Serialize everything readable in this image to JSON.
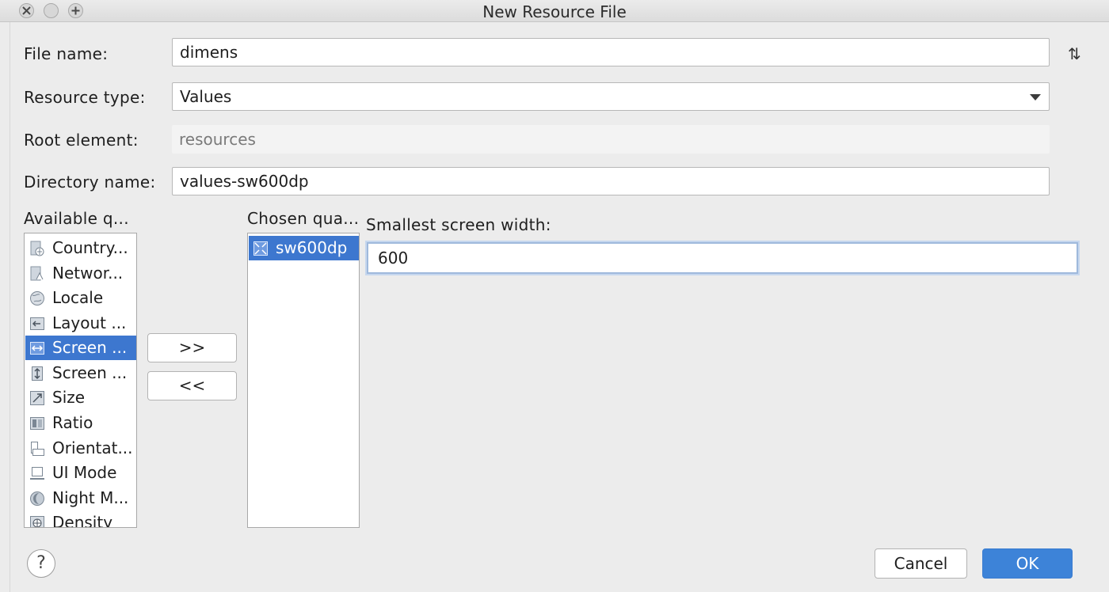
{
  "window": {
    "title": "New Resource File"
  },
  "form": {
    "file_name_label": "File name:",
    "file_name_value": "dimens",
    "resource_type_label": "Resource type:",
    "resource_type_value": "Values",
    "root_element_label": "Root element:",
    "root_element_value": "resources",
    "directory_name_label": "Directory name:",
    "directory_name_value": "values-sw600dp"
  },
  "qualifiers": {
    "available_label": "Available q...",
    "chosen_label": "Chosen qua...",
    "available": [
      {
        "label": "Country...",
        "icon": "country-icon"
      },
      {
        "label": "Networ...",
        "icon": "network-icon"
      },
      {
        "label": "Locale",
        "icon": "globe-icon"
      },
      {
        "label": "Layout ...",
        "icon": "layout-direction-icon"
      },
      {
        "label": "Screen ...",
        "icon": "screen-width-icon",
        "selected": true
      },
      {
        "label": "Screen ...",
        "icon": "screen-height-icon"
      },
      {
        "label": "Size",
        "icon": "size-icon"
      },
      {
        "label": "Ratio",
        "icon": "ratio-icon"
      },
      {
        "label": "Orientat...",
        "icon": "orientation-icon"
      },
      {
        "label": "UI Mode",
        "icon": "ui-mode-icon"
      },
      {
        "label": "Night M...",
        "icon": "night-mode-icon"
      },
      {
        "label": "Density",
        "icon": "density-icon"
      }
    ],
    "chosen": [
      {
        "label": "sw600dp",
        "icon": "smallest-width-icon",
        "selected": true
      }
    ],
    "add_button": ">>",
    "remove_button": "<<"
  },
  "detail": {
    "label": "Smallest screen width:",
    "value": "600"
  },
  "footer": {
    "help": "?",
    "cancel": "Cancel",
    "ok": "OK"
  }
}
